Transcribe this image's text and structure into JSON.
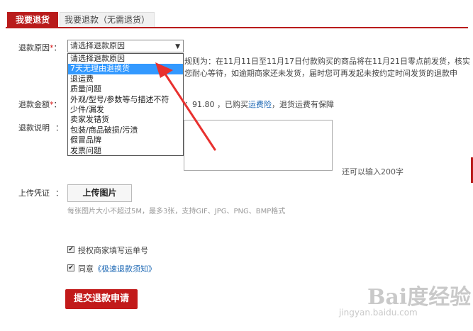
{
  "tabs": {
    "active": "我要退货",
    "inactive": "我要退款（无需退货）"
  },
  "form": {
    "reason_label": "退款原因",
    "required_mark": "*",
    "reason_selected": "请选择退款原因",
    "reason_options": [
      "请选择退款原因",
      "7天无理由退换货",
      "退运费",
      "质量问题",
      "外观/型号/参数等与描述不符",
      "少件/漏发",
      "卖家发错货",
      "包装/商品破损/污渍",
      "假冒品牌",
      "发票问题"
    ],
    "highlighted_option_index": 1,
    "notice_line1": "规则为：在11月11日至11月17日付款购买的商品将在11月21日零点前发货，核实",
    "notice_line2": "您耐心等待，如逾期商家还未发货，届时您可再发起未按约定时间发货的退款申",
    "amount_label": "退款金额",
    "amount_text_prefix": "：91.80 ，已购买",
    "amount_link": "运费险",
    "amount_text_suffix": "，退货运费有保障",
    "desc_label": "退款说明",
    "desc_colon": "：",
    "char_hint": "还可以输入200字",
    "voucher_label": "上传凭证",
    "voucher_colon": "：",
    "upload_button": "上传图片",
    "upload_hint": "每张图片大小不超过5M，最多3张，支持GIF、JPG、PNG、BMP格式",
    "checkbox1_label": "授权商家填写运单号",
    "checkbox2_prefix": "同意",
    "checkbox2_link": "《极速退款须知》",
    "submit_button": "提交退款申请"
  },
  "watermark": {
    "brand": "Bai度经验",
    "url": "jingyan.baidu.com"
  },
  "colors": {
    "brand_red": "#b91b1b",
    "highlight_blue": "#3399ff",
    "link_blue": "#1a66b3",
    "arrow_red": "#e8312f"
  },
  "icons": {
    "select_arrow": "triangle-down-icon",
    "annotation": "red-arrow-icon"
  }
}
